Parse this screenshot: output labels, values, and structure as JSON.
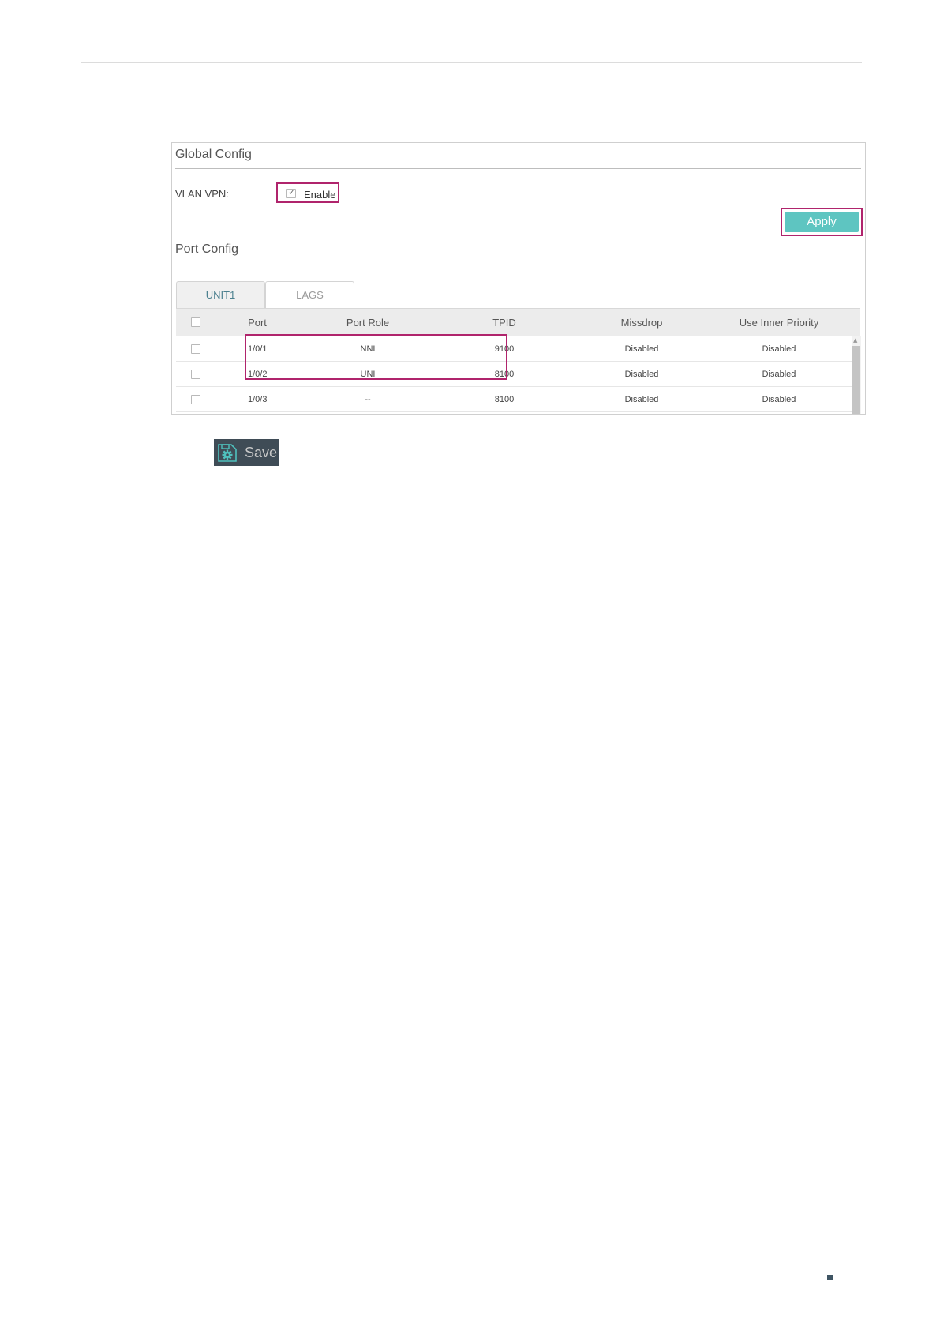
{
  "global_config": {
    "title": "Global Config",
    "vlan_vpn_label": "VLAN VPN:",
    "enable_label": "Enable",
    "enable_checked": true,
    "apply_label": "Apply"
  },
  "port_config": {
    "title": "Port Config",
    "tabs": [
      {
        "label": "UNIT1",
        "active": true
      },
      {
        "label": "LAGS",
        "active": false
      }
    ],
    "columns": [
      "Port",
      "Port Role",
      "TPID",
      "Missdrop",
      "Use Inner Priority"
    ],
    "rows": [
      {
        "port": "1/0/1",
        "role": "NNI",
        "tpid": "9100",
        "missdrop": "Disabled",
        "inner_priority": "Disabled"
      },
      {
        "port": "1/0/2",
        "role": "UNI",
        "tpid": "8100",
        "missdrop": "Disabled",
        "inner_priority": "Disabled"
      },
      {
        "port": "1/0/3",
        "role": "--",
        "tpid": "8100",
        "missdrop": "Disabled",
        "inner_priority": "Disabled"
      }
    ]
  },
  "save_label": "Save",
  "icons": [
    "checkbox-icon",
    "save-gear-icon",
    "scroll-up-arrow-icon"
  ],
  "colors": {
    "accent": "#5ec5c1",
    "highlight": "#b0246c",
    "save_bg": "#3f4c56"
  }
}
